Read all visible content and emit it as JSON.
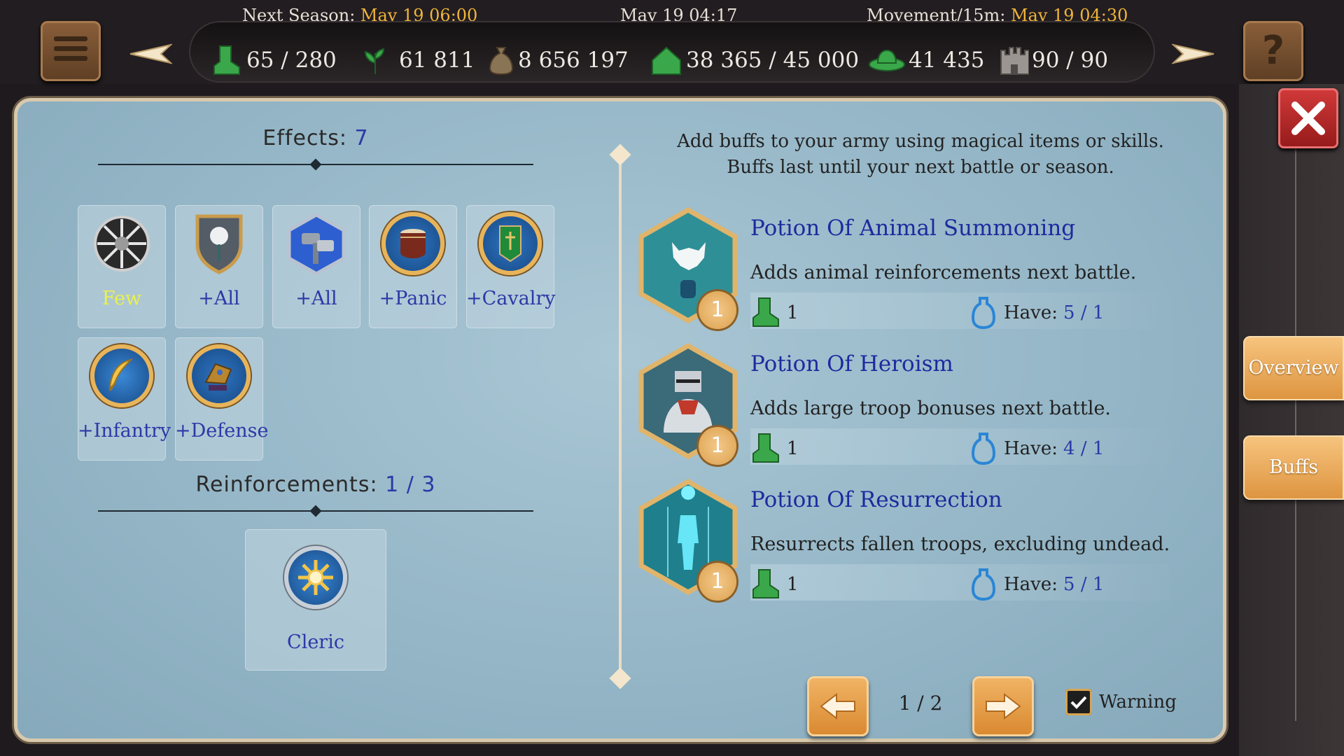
{
  "topbar": {
    "next_season_label": "Next Season:",
    "next_season_value": "May 19 06:00",
    "current_time": "May 19 04:17",
    "movement_label": "Movement/15m:",
    "movement_value": "May 19 04:30",
    "menu_icon": "hamburger-menu-icon",
    "help_label": "?",
    "resources": [
      {
        "icon": "boot-icon",
        "value": "65 / 280"
      },
      {
        "icon": "plant-icon",
        "value": "61 811"
      },
      {
        "icon": "money-bag-icon",
        "value": "8 656 197"
      },
      {
        "icon": "house-icon",
        "value": "38 365 / 45 000"
      },
      {
        "icon": "hat-icon",
        "value": "41 435"
      },
      {
        "icon": "castle-icon",
        "value": "90 / 90"
      }
    ]
  },
  "effects": {
    "title": "Effects:",
    "count": "7",
    "items": [
      {
        "label": "Few",
        "icon": "snowflake-icon"
      },
      {
        "label": "+All",
        "icon": "rose-shield-icon"
      },
      {
        "label": "+All",
        "icon": "hammer-hexagon-icon"
      },
      {
        "label": "+Panic",
        "icon": "drum-icon"
      },
      {
        "label": "+Cavalry",
        "icon": "banner-icon"
      },
      {
        "label": "+Infantry",
        "icon": "feather-icon"
      },
      {
        "label": "+Defense",
        "icon": "gauntlet-icon"
      }
    ]
  },
  "reinforcements": {
    "title": "Reinforcements:",
    "count": "1 / 3",
    "items": [
      {
        "label": "Cleric",
        "icon": "sun-icon"
      }
    ]
  },
  "intro": {
    "line1": "Add buffs to your army using magical items or skills.",
    "line2": "Buffs last until your next battle or season."
  },
  "potions": [
    {
      "title": "Potion Of Animal Summoning",
      "desc": "Adds animal reinforcements next battle.",
      "badge": "1",
      "cost": "1",
      "have_label": "Have:",
      "have": "5 / 1",
      "icon": "wolf-potion-icon",
      "color": "#2f8f96"
    },
    {
      "title": "Potion Of Heroism",
      "desc": "Adds large troop bonuses next battle.",
      "badge": "1",
      "cost": "1",
      "have_label": "Have:",
      "have": "4 / 1",
      "icon": "knight-icon",
      "color": "#3b6a78"
    },
    {
      "title": "Potion Of Resurrection",
      "desc": "Resurrects fallen troops, excluding undead.",
      "badge": "1",
      "cost": "1",
      "have_label": "Have:",
      "have": "5 / 1",
      "icon": "resurrection-icon",
      "color": "#1f7f8c"
    }
  ],
  "pagination": {
    "page": "1 / 2"
  },
  "warning": {
    "label": "Warning",
    "checked": true
  },
  "sidebar": {
    "tabs": [
      "Overview",
      "Buffs"
    ]
  },
  "colors": {
    "accent_blue": "#2c39a6",
    "gold": "#f0b43a",
    "close_red": "#c62f2f"
  }
}
